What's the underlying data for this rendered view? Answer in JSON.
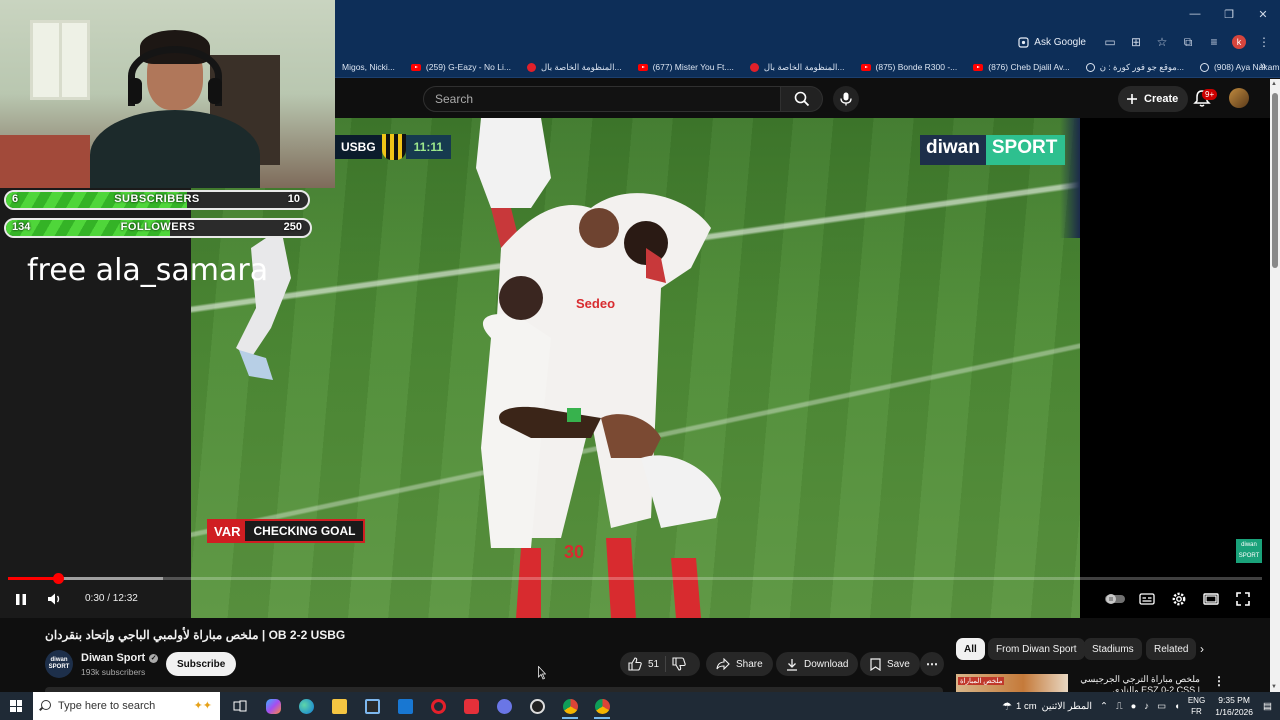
{
  "browser": {
    "window_controls": [
      "—",
      "❐",
      "✕"
    ],
    "ask_google": "Ask Google",
    "profile_initial": "k",
    "bookmarks": [
      {
        "icon": "youtube",
        "label": "Migos, Nicki..."
      },
      {
        "icon": "youtube",
        "label": "(259) G-Eazy - No Li..."
      },
      {
        "icon": "red-circle",
        "label": "المنظومة الخاصة بال..."
      },
      {
        "icon": "youtube",
        "label": "(677) Mister You Ft...."
      },
      {
        "icon": "red-circle",
        "label": "المنظومة الخاصة بال..."
      },
      {
        "icon": "youtube",
        "label": "(875) Bonde R300 -..."
      },
      {
        "icon": "youtube",
        "label": "(876) Cheb Djalil Av..."
      },
      {
        "icon": "globe",
        "label": "موقع جو فور كورة : ن..."
      },
      {
        "icon": "globe",
        "label": "(908) Aya Nakamura..."
      }
    ],
    "bookmarks_overflow": "»"
  },
  "youtube_header": {
    "search_placeholder": "Search",
    "create_label": "Create",
    "notification_count": "9+"
  },
  "stream_overlay": {
    "subscribers": {
      "current": "6",
      "label": "SUBSCRIBERS",
      "goal": "10",
      "progress": 0.6
    },
    "followers": {
      "current": "134",
      "label": "FOLLOWERS",
      "goal": "250",
      "progress": 0.54
    },
    "free_text": "free ala_samara"
  },
  "video": {
    "score_team": "USBG",
    "score_time": "11:11",
    "broadcaster_left": "diwan",
    "broadcaster_right": "SPORT",
    "var_tag": "VAR",
    "var_text": "CHECKING GOAL",
    "corner_logo_top": "diwan",
    "corner_logo_bottom": "SPORT",
    "jersey_number": "30",
    "sponsor_text": "Sedeo",
    "time_current": "0:30",
    "time_total": "12:32",
    "timecode": "0:30 / 12:32",
    "played_fraction": 0.04,
    "buffered_fraction": 0.124
  },
  "video_info": {
    "title": "ملخص مباراة لأولمبي الباجي وإتحاد بنقردان | OB 2-2 USBG",
    "channel_name": "Diwan Sport",
    "channel_avatar_top": "diwan",
    "channel_avatar_bottom": "SPORT",
    "subscribers": "193k subscribers",
    "subscribe_label": "Subscribe",
    "like_count": "51",
    "share_label": "Share",
    "download_label": "Download",
    "save_label": "Save"
  },
  "related": {
    "chips": [
      "All",
      "From Diwan Sport",
      "Stadiums",
      "Related"
    ],
    "first_item_title": "ملخص مباراة الترجي الجرجيسي والنادي ESZ 0-2 CSS | ...الصفاقسي",
    "first_item_thumb_text": "ملخص المباراة"
  },
  "taskbar": {
    "search_placeholder": "Type here to search",
    "weather_text": "1 cm",
    "weather_desc": "المطر الاثنين",
    "lang_top": "ENG",
    "lang_bottom": "FR",
    "time": "9:35 PM",
    "date": "1/16/2026"
  }
}
